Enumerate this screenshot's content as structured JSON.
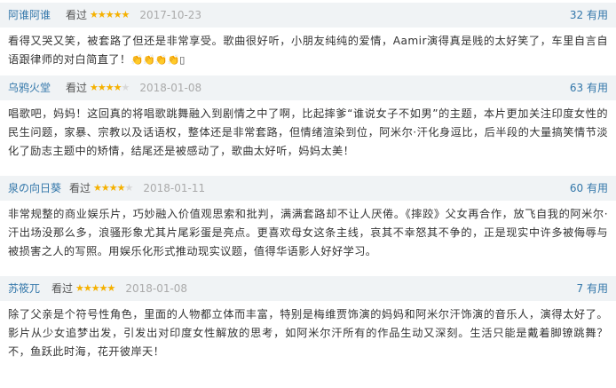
{
  "reviews": [
    {
      "author": "阿谁阿谁",
      "action": "看过",
      "stars": "★★★★★",
      "stars_empty": "",
      "rating": 5,
      "date": "2017-10-23",
      "votes": "32 有用",
      "text": "看得又哭又笑，被套路了但还是非常享受。歌曲很好听，小朋友纯纯的爱情，Aamir演得真是贱的太好笑了，车里自言自语跟律师的对白简直了！",
      "emoji": "👏👏👏👏▯"
    },
    {
      "author": "乌鸦火堂",
      "action": "看过",
      "stars": "★★★★",
      "stars_empty": "★",
      "rating": 4,
      "date": "2018-01-08",
      "votes": "63 有用",
      "text": "唱歌吧，妈妈！这回真的将唱歌跳舞融入到剧情之中了啊，比起摔爹“谁说女子不如男”的主题，本片更加关注印度女性的民生问题，家暴、宗教以及话语权，整体还是非常套路，但情绪渲染到位，阿米尔·汗化身逗比，后半段的大量搞笑情节淡化了励志主题中的矫情，结尾还是被感动了，歌曲太好听，妈妈太美！"
    },
    {
      "author": "泉の向日葵",
      "action": "看过",
      "stars": "★★★★",
      "stars_empty": "★",
      "rating": 4,
      "date": "2018-01-11",
      "votes": "60 有用",
      "text": "非常规整的商业娱乐片，巧妙融入价值观思索和批判，满满套路却不让人厌倦。《摔跤》父女再合作，放飞自我的阿米尔·汗出场没那么多，浪骚形象尤其片尾彩蛋是亮点。更喜欢母女这条主线，哀其不幸怒其不争的，正是现实中许多被侮辱与被损害之人的写照。用娱乐化形式推动现实议题，值得华语影人好好学习。"
    },
    {
      "author": "苏筱兀",
      "action": "看过",
      "stars": "★★★★★",
      "stars_empty": "",
      "rating": 5,
      "date": "2018-01-08",
      "votes": "7 有用",
      "text": "除了父亲是个符号性角色，里面的人物都立体而丰富，特别是梅维贾饰演的妈妈和阿米尔汗饰演的音乐人，演得太好了。影片从少女追梦出发，引发出对印度女性解放的思考，如阿米尔汗所有的作品生动又深刻。生活只能是戴着脚镣跳舞？不，鱼跃此时海，花开彼岸天！"
    }
  ],
  "colors": {
    "author": "#3377aa",
    "star": "#f5b100",
    "header_bg": "#f0f3f5",
    "date": "#aaaaaa",
    "body_text": "#333333"
  }
}
